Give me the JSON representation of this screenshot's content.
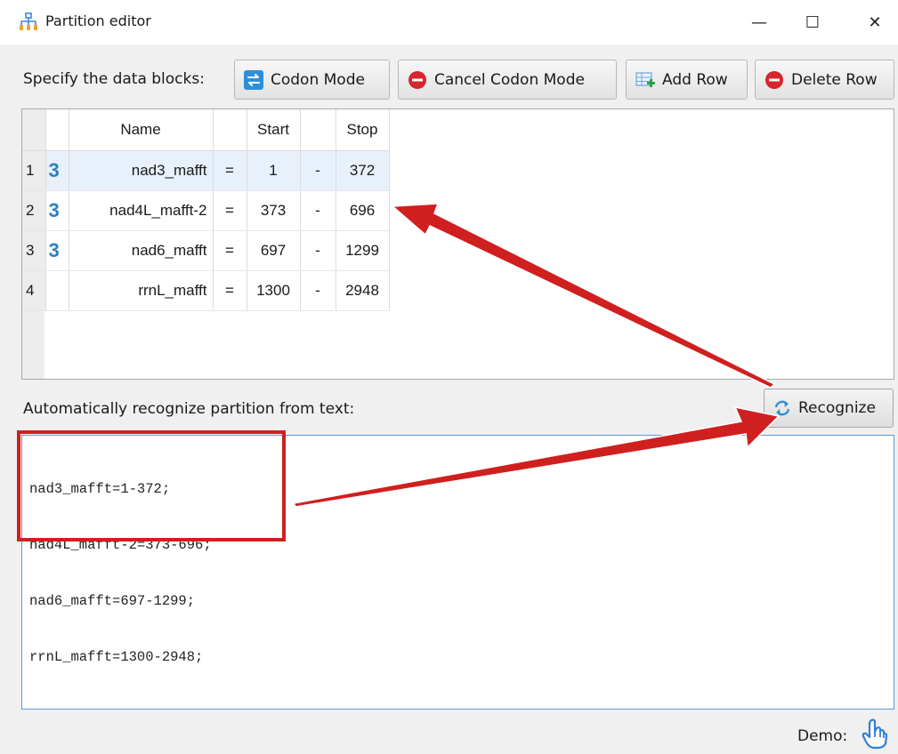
{
  "window": {
    "title": "Partition editor",
    "controls": {
      "minimize": "—",
      "maximize": "☐",
      "close": "✕"
    }
  },
  "toolbar": {
    "label": "Specify the data blocks:",
    "codon_mode": "Codon Mode",
    "cancel_codon_mode": "Cancel Codon Mode",
    "add_row": "Add Row",
    "delete_row": "Delete Row"
  },
  "table": {
    "headers": {
      "name": "Name",
      "start": "Start",
      "stop": "Stop"
    },
    "rows": [
      {
        "index": "1",
        "codon": "3",
        "name": "nad3_mafft",
        "eq": "=",
        "start": "1",
        "dash": "-",
        "stop": "372",
        "selected": true
      },
      {
        "index": "2",
        "codon": "3",
        "name": "nad4L_mafft-2",
        "eq": "=",
        "start": "373",
        "dash": "-",
        "stop": "696",
        "selected": false
      },
      {
        "index": "3",
        "codon": "3",
        "name": "nad6_mafft",
        "eq": "=",
        "start": "697",
        "dash": "-",
        "stop": "1299",
        "selected": false
      },
      {
        "index": "4",
        "codon": "",
        "name": "rrnL_mafft",
        "eq": "=",
        "start": "1300",
        "dash": "-",
        "stop": "2948",
        "selected": false
      }
    ]
  },
  "recognize": {
    "label": "Automatically recognize partition from text:",
    "button": "Recognize"
  },
  "text_input": {
    "lines": [
      "nad3_mafft=1-372;",
      "nad4L_mafft-2=373-696;",
      "nad6_mafft=697-1299;",
      "rrnL_mafft=1300-2948;"
    ]
  },
  "demo": {
    "label": "Demo:"
  },
  "colors": {
    "accent_blue": "#2c7fc1",
    "annotation_red": "#d01f1f",
    "delete_red": "#d6262b"
  },
  "icons": {
    "app": "tree-partition-icon",
    "codon_mode": "swap-arrows-icon",
    "cancel_codon_mode": "minus-circle-icon",
    "add_row": "add-row-icon",
    "delete_row": "minus-circle-icon",
    "recognize": "refresh-icon",
    "demo": "hand-pointer-icon"
  }
}
